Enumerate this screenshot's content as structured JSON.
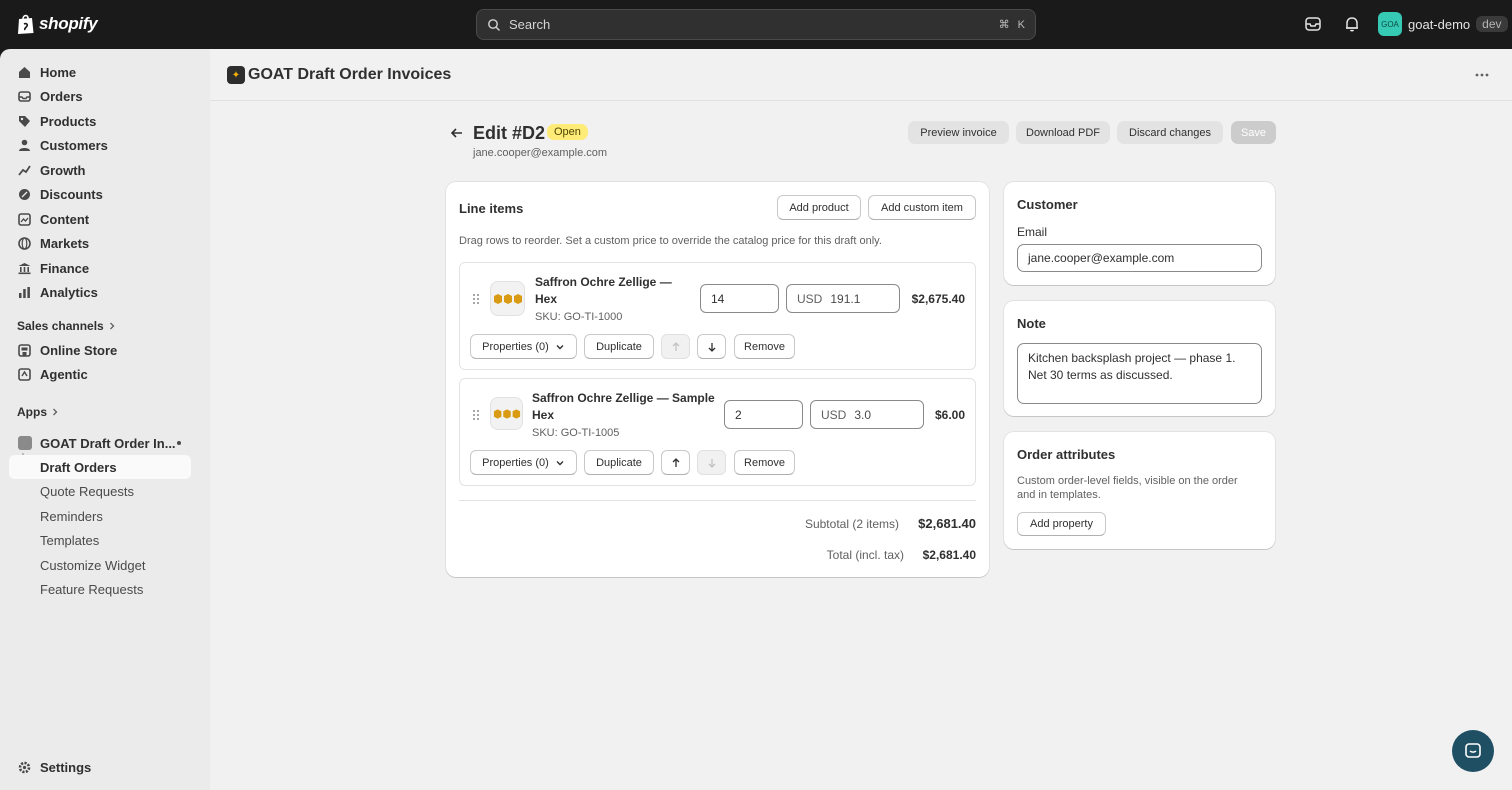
{
  "topbar": {
    "brand": "shopify",
    "search_placeholder": "Search",
    "shortcut_cmd": "⌘",
    "shortcut_key": "K",
    "store_avatar": "GOA",
    "store_name": "goat-demo",
    "env_badge": "dev"
  },
  "sidebar": {
    "items": [
      {
        "label": "Home",
        "icon": "home-icon"
      },
      {
        "label": "Orders",
        "icon": "inbox-icon"
      },
      {
        "label": "Products",
        "icon": "tag-icon"
      },
      {
        "label": "Customers",
        "icon": "person-icon"
      },
      {
        "label": "Growth",
        "icon": "growth-icon"
      },
      {
        "label": "Discounts",
        "icon": "discount-icon"
      },
      {
        "label": "Content",
        "icon": "content-icon"
      },
      {
        "label": "Markets",
        "icon": "globe-icon"
      },
      {
        "label": "Finance",
        "icon": "bank-icon"
      },
      {
        "label": "Analytics",
        "icon": "chart-icon"
      }
    ],
    "sales_channels_label": "Sales channels",
    "channels": [
      {
        "label": "Online Store",
        "icon": "store-icon"
      },
      {
        "label": "Agentic",
        "icon": "agent-icon"
      }
    ],
    "apps_label": "Apps",
    "app": {
      "label": "GOAT Draft Order In..."
    },
    "app_subitems": [
      {
        "label": "Draft Orders",
        "active": true
      },
      {
        "label": "Quote Requests"
      },
      {
        "label": "Reminders"
      },
      {
        "label": "Templates"
      },
      {
        "label": "Customize Widget"
      },
      {
        "label": "Feature Requests"
      }
    ],
    "settings_label": "Settings"
  },
  "app_header": {
    "title": "GOAT Draft Order Invoices"
  },
  "page": {
    "title": "Edit #D2",
    "status": "Open",
    "subtitle": "jane.cooper@example.com",
    "actions": {
      "preview": "Preview invoice",
      "download": "Download PDF",
      "discard": "Discard changes",
      "save": "Save"
    }
  },
  "line_items": {
    "title": "Line items",
    "add_product": "Add product",
    "add_custom": "Add custom item",
    "hint": "Drag rows to reorder. Set a custom price to override the catalog price for this draft only.",
    "rows": [
      {
        "name": "Saffron Ochre Zellige — Hex",
        "sku": "SKU: GO-TI-1000",
        "qty": "14",
        "currency": "USD",
        "price": "191.1",
        "amount": "$2,675.40",
        "properties": "Properties (0)",
        "duplicate": "Duplicate",
        "remove": "Remove"
      },
      {
        "name": "Saffron Ochre Zellige — Sample Hex",
        "sku": "SKU: GO-TI-1005",
        "qty": "2",
        "currency": "USD",
        "price": "3.0",
        "amount": "$6.00",
        "properties": "Properties (0)",
        "duplicate": "Duplicate",
        "remove": "Remove"
      }
    ],
    "subtotal_label": "Subtotal (2 items)",
    "subtotal_value": "$2,681.40",
    "total_label": "Total (incl. tax)",
    "total_value": "$2,681.40"
  },
  "customer": {
    "title": "Customer",
    "email_label": "Email",
    "email_value": "jane.cooper@example.com"
  },
  "note": {
    "title": "Note",
    "value": "Kitchen backsplash project — phase 1. Net 30 terms as discussed."
  },
  "order_attributes": {
    "title": "Order attributes",
    "description": "Custom order-level fields, visible on the order and in templates.",
    "add_property": "Add property"
  },
  "colors": {
    "topbar": "#1a1a1a",
    "sidebar": "#ebebeb",
    "main": "#f1f1f1",
    "badge_open": "#ffeb78",
    "chat_button": "#1f4f63"
  }
}
